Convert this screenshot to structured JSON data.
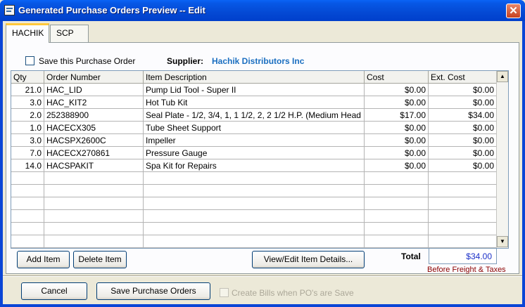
{
  "window": {
    "title": "Generated Purchase Orders Preview -- Edit",
    "close_glyph": "✕"
  },
  "tabs": [
    {
      "label": "HACHIK",
      "active": true
    },
    {
      "label": "SCP",
      "active": false
    }
  ],
  "form": {
    "save_po_label": "Save this Purchase Order",
    "save_po_checked": false,
    "supplier_label": "Supplier:",
    "supplier_value": "Hachik Distributors Inc"
  },
  "grid": {
    "headers": [
      "Qty",
      "Order Number",
      "Item Description",
      "Cost",
      "Ext. Cost"
    ],
    "rows": [
      {
        "qty": "21.0",
        "order": "HAC_LID",
        "desc": "Pump Lid Tool - Super II",
        "cost": "$0.00",
        "ext": "$0.00"
      },
      {
        "qty": "3.0",
        "order": "HAC_KIT2",
        "desc": "Hot Tub Kit",
        "cost": "$0.00",
        "ext": "$0.00"
      },
      {
        "qty": "2.0",
        "order": "252388900",
        "desc": "Seal Plate - 1/2, 3/4, 1, 1 1/2, 2, 2 1/2 H.P. (Medium Head",
        "cost": "$17.00",
        "ext": "$34.00"
      },
      {
        "qty": "1.0",
        "order": "HACECX305",
        "desc": "Tube Sheet Support",
        "cost": "$0.00",
        "ext": "$0.00"
      },
      {
        "qty": "3.0",
        "order": "HACSPX2600C",
        "desc": "Impeller",
        "cost": "$0.00",
        "ext": "$0.00"
      },
      {
        "qty": "7.0",
        "order": "HACECX270861",
        "desc": "Pressure Gauge",
        "cost": "$0.00",
        "ext": "$0.00"
      },
      {
        "qty": "14.0",
        "order": "HACSPAKIT",
        "desc": "Spa Kit for Repairs",
        "cost": "$0.00",
        "ext": "$0.00"
      }
    ],
    "empty_rows": 6,
    "scroll_up_glyph": "▲",
    "scroll_down_glyph": "▼"
  },
  "actions": {
    "add_item": "Add Item",
    "delete_item": "Delete Item",
    "view_edit": "View/Edit Item Details..."
  },
  "totals": {
    "label": "Total",
    "value": "$34.00",
    "note": "Before Freight & Taxes"
  },
  "footer": {
    "cancel": "Cancel",
    "save_pos": "Save Purchase Orders",
    "create_bills_label": "Create Bills when PO's are Save",
    "create_bills_checked": false,
    "create_bills_enabled": false
  },
  "colors": {
    "titlebar": "#0449d4",
    "supplier_accent": "#1a6ec0",
    "total_value": "#1a2fc8",
    "footnote": "#8b0000"
  },
  "icons": [
    "app-icon",
    "close-icon",
    "scroll-up-icon",
    "scroll-down-icon"
  ]
}
